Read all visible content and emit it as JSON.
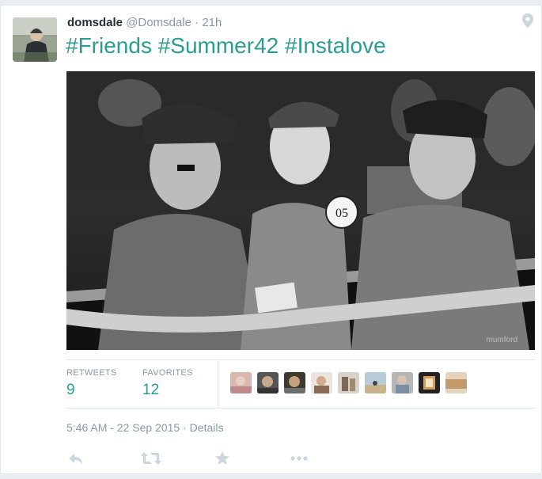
{
  "tweet": {
    "fullname": "domsdale",
    "username": "@Domsdale",
    "separator": "·",
    "timestamp": "21h",
    "text": "#Friends #Summer42 #Instalove",
    "image_watermark": "mumford",
    "badge_number": "05"
  },
  "stats": {
    "retweets_label": "RETWEETS",
    "retweets_count": "9",
    "favorites_label": "FAVORITES",
    "favorites_count": "12"
  },
  "meta": {
    "datetime": "5:46 AM - 22 Sep 2015",
    "separator": "·",
    "details_link": "Details"
  },
  "icons": [
    "map-pin-icon",
    "reply-icon",
    "retweet-icon",
    "favorite-star-icon",
    "more-icon"
  ],
  "colors": {
    "accent": "#2b9d8f",
    "muted": "#8899a6",
    "border": "#e1e8ed",
    "action_icon": "#ccd6dd"
  }
}
